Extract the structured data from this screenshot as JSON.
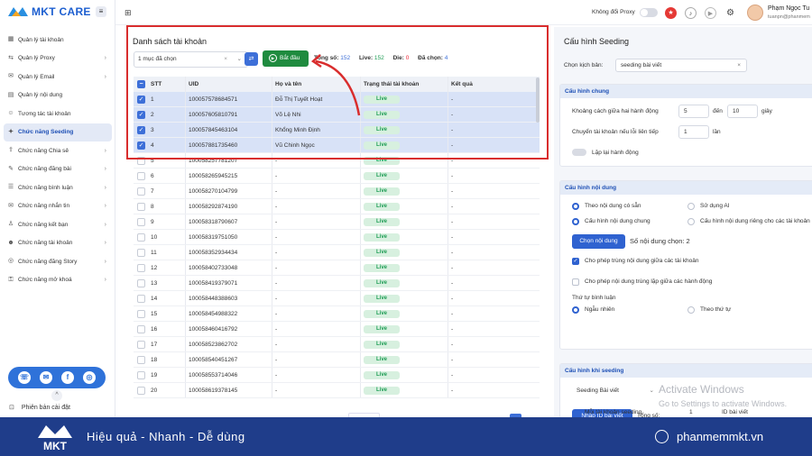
{
  "app": {
    "logo_text": "MKT CARE",
    "menu_icon": "≡"
  },
  "sidebar": {
    "items": [
      {
        "label": "Quản lý tài khoản",
        "icon": "grid-icon",
        "chevron": false,
        "active": false
      },
      {
        "label": "Quản lý Proxy",
        "icon": "proxy-icon",
        "chevron": true,
        "active": false
      },
      {
        "label": "Quản lý Email",
        "icon": "email-icon",
        "chevron": true,
        "active": false
      },
      {
        "label": "Quản lý nội dung",
        "icon": "content-icon",
        "chevron": false,
        "active": false
      },
      {
        "label": "Tương tác tài khoản",
        "icon": "interact-icon",
        "chevron": false,
        "active": false
      },
      {
        "label": "Chức năng Seeding",
        "icon": "seeding-icon",
        "chevron": false,
        "active": true
      },
      {
        "label": "Chức năng Chia sẻ",
        "icon": "share-icon",
        "chevron": true,
        "active": false
      },
      {
        "label": "Chức năng đăng bài",
        "icon": "post-icon",
        "chevron": true,
        "active": false
      },
      {
        "label": "Chức năng bình luận",
        "icon": "comment-icon",
        "chevron": true,
        "active": false
      },
      {
        "label": "Chức năng nhắn tin",
        "icon": "message-icon",
        "chevron": true,
        "active": false
      },
      {
        "label": "Chức năng kết bạn",
        "icon": "friend-icon",
        "chevron": true,
        "active": false
      },
      {
        "label": "Chức năng tài khoản",
        "icon": "account-icon",
        "chevron": true,
        "active": false
      },
      {
        "label": "Chức năng đăng Story",
        "icon": "story-icon",
        "chevron": true,
        "active": false
      },
      {
        "label": "Chức năng mở khoá",
        "icon": "unlock-icon",
        "chevron": true,
        "active": false
      }
    ],
    "version_label": "Phiên bản cài đặt",
    "collapse_icon": "^"
  },
  "topbar": {
    "proxy_label": "Không đổi Proxy",
    "user_name": "Phạm Ngọc Tu",
    "user_email": "tuanpn@phanmem"
  },
  "accounts": {
    "title": "Danh sách tài khoản",
    "select_value": "1 mục đã chọn",
    "start_label": "Bắt đầu",
    "stats": {
      "total_label": "Tổng số:",
      "total": "152",
      "live_label": "Live:",
      "live": "152",
      "die_label": "Die:",
      "die": "0",
      "selected_label": "Đã chọn:",
      "selected": "4"
    },
    "columns": [
      "STT",
      "UID",
      "Họ và tên",
      "Trạng thái tài khoản",
      "Kết quả"
    ],
    "rows": [
      {
        "stt": "1",
        "uid": "100057578684571",
        "name": "Đỗ Thị Tuyết Hoạt",
        "status": "Live",
        "result": "-",
        "checked": true
      },
      {
        "stt": "2",
        "uid": "100057605810791",
        "name": "Võ Lệ Nhi",
        "status": "Live",
        "result": "-",
        "checked": true
      },
      {
        "stt": "3",
        "uid": "100057845463104",
        "name": "Khổng Minh Định",
        "status": "Live",
        "result": "-",
        "checked": true
      },
      {
        "stt": "4",
        "uid": "100057881735460",
        "name": "Vũ Chinh Ngọc",
        "status": "Live",
        "result": "-",
        "checked": true
      },
      {
        "stt": "5",
        "uid": "100058257781207",
        "name": "-",
        "status": "Live",
        "result": "-",
        "checked": false
      },
      {
        "stt": "6",
        "uid": "100058265945215",
        "name": "-",
        "status": "Live",
        "result": "-",
        "checked": false
      },
      {
        "stt": "7",
        "uid": "100058270104799",
        "name": "-",
        "status": "Live",
        "result": "-",
        "checked": false
      },
      {
        "stt": "8",
        "uid": "100058292874190",
        "name": "-",
        "status": "Live",
        "result": "-",
        "checked": false
      },
      {
        "stt": "9",
        "uid": "100058318790607",
        "name": "-",
        "status": "Live",
        "result": "-",
        "checked": false
      },
      {
        "stt": "10",
        "uid": "100058319751050",
        "name": "-",
        "status": "Live",
        "result": "-",
        "checked": false
      },
      {
        "stt": "11",
        "uid": "100058352934434",
        "name": "-",
        "status": "Live",
        "result": "-",
        "checked": false
      },
      {
        "stt": "12",
        "uid": "100058402733048",
        "name": "-",
        "status": "Live",
        "result": "-",
        "checked": false
      },
      {
        "stt": "13",
        "uid": "100058419379071",
        "name": "-",
        "status": "Live",
        "result": "-",
        "checked": false
      },
      {
        "stt": "14",
        "uid": "100058448388603",
        "name": "-",
        "status": "Live",
        "result": "-",
        "checked": false
      },
      {
        "stt": "15",
        "uid": "100058454988322",
        "name": "-",
        "status": "Live",
        "result": "-",
        "checked": false
      },
      {
        "stt": "16",
        "uid": "100058460416792",
        "name": "-",
        "status": "Live",
        "result": "-",
        "checked": false
      },
      {
        "stt": "17",
        "uid": "100058523862702",
        "name": "-",
        "status": "Live",
        "result": "-",
        "checked": false
      },
      {
        "stt": "18",
        "uid": "100058540451267",
        "name": "-",
        "status": "Live",
        "result": "-",
        "checked": false
      },
      {
        "stt": "19",
        "uid": "100058553714046",
        "name": "-",
        "status": "Live",
        "result": "-",
        "checked": false
      },
      {
        "stt": "20",
        "uid": "100058619378145",
        "name": "-",
        "status": "Live",
        "result": "-",
        "checked": false
      }
    ]
  },
  "config": {
    "title": "Cấu hình Seeding",
    "script_label": "Chọn kịch bản:",
    "script_value": "seeding bài viết",
    "general": {
      "header": "Cấu hình chung",
      "gap_label": "Khoảng cách giữa hai hành động",
      "gap_from": "5",
      "to_label": "đến",
      "gap_to": "10",
      "unit_seconds": "giây",
      "switch_label": "Chuyển tài khoản nếu lỗi liên tiếp",
      "switch_value": "1",
      "unit_times": "lần",
      "repeat_label": "Lặp lại hành động"
    },
    "content": {
      "header": "Cấu hình nội dung",
      "opt_existing": "Theo nội dung có sẵn",
      "opt_ai": "Sử dụng AI",
      "opt_common": "Cấu hình nội dung chung",
      "opt_separate": "Cấu hình nội dung riêng cho các tài khoản",
      "choose_btn": "Chọn nội dung",
      "count_text": "Số nội dung chọn: 2",
      "allow_dup_accounts": "Cho phép trùng nội dung giữa các tài khoản",
      "allow_dup_actions": "Cho phép nội dung trùng lặp giữa các hành động",
      "order_label": "Thứ tự bình luận",
      "opt_random": "Ngẫu nhiên",
      "opt_sequence": "Theo thứ tự"
    },
    "seeding": {
      "header": "Cấu hình khi seeding",
      "type_value": "Seeding Bài viết",
      "import_btn": "Nhập ID bài viết",
      "total_label": "Tổng số:",
      "per_account_label": "Mỗi tài khoản seeding",
      "per_account_value": "1",
      "post_id_label": "ID bài viết"
    }
  },
  "watermark": {
    "line1": "Activate Windows",
    "line2": "Go to Settings to activate Windows."
  },
  "footer": {
    "logo_text": "MKT",
    "slogan": "Hiệu quả - Nhanh - Dễ dùng",
    "site": "phanmemmkt.vn"
  },
  "colors": {
    "accent": "#2f62d0",
    "success": "#1f8b3f",
    "highlight": "#d92d2d",
    "footer": "#1f3d8a"
  }
}
